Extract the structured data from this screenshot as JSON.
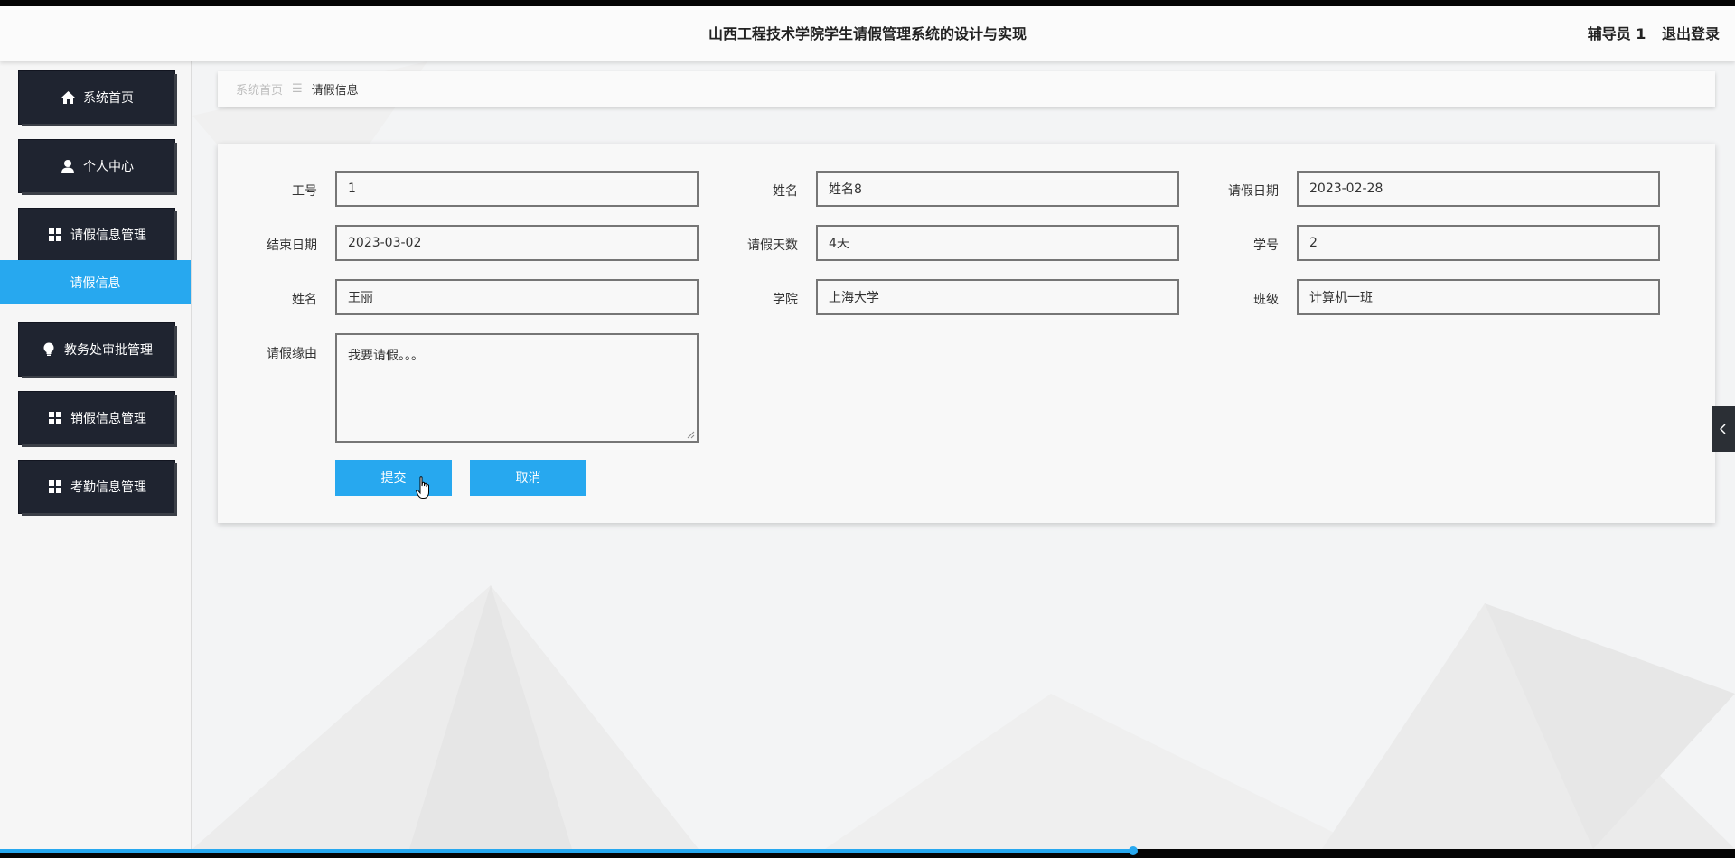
{
  "header": {
    "title": "山西工程技术学院学生请假管理系统的设计与实现",
    "user": "辅导员 1",
    "logout": "退出登录"
  },
  "sidebar": {
    "items": [
      {
        "label": "系统首页",
        "icon": "home-icon"
      },
      {
        "label": "个人中心",
        "icon": "user-icon"
      },
      {
        "label": "请假信息管理",
        "icon": "grid-icon"
      },
      {
        "label": "教务处审批管理",
        "icon": "lightbulb-icon"
      },
      {
        "label": "销假信息管理",
        "icon": "grid-icon"
      },
      {
        "label": "考勤信息管理",
        "icon": "grid-icon"
      }
    ],
    "active_sub": "请假信息"
  },
  "breadcrumb": {
    "home": "系统首页",
    "current": "请假信息"
  },
  "form": {
    "fields": {
      "gonghao": {
        "label": "工号",
        "value": "1"
      },
      "xingming1": {
        "label": "姓名",
        "value": "姓名8"
      },
      "qingjia_riqi": {
        "label": "请假日期",
        "value": "2023-02-28"
      },
      "jieshu_riqi": {
        "label": "结束日期",
        "value": "2023-03-02"
      },
      "qingjia_tianshu": {
        "label": "请假天数",
        "value": "4天"
      },
      "xuehao": {
        "label": "学号",
        "value": "2"
      },
      "xingming2": {
        "label": "姓名",
        "value": "王丽"
      },
      "xueyuan": {
        "label": "学院",
        "value": "上海大学"
      },
      "banji": {
        "label": "班级",
        "value": "计算机一班"
      },
      "yuanyou": {
        "label": "请假缘由",
        "value": "我要请假。。。"
      }
    },
    "submit_label": "提交",
    "cancel_label": "取消"
  },
  "colors": {
    "accent": "#27a8ef",
    "menu_bg": "#1f2430"
  },
  "video_progress": 0.653
}
